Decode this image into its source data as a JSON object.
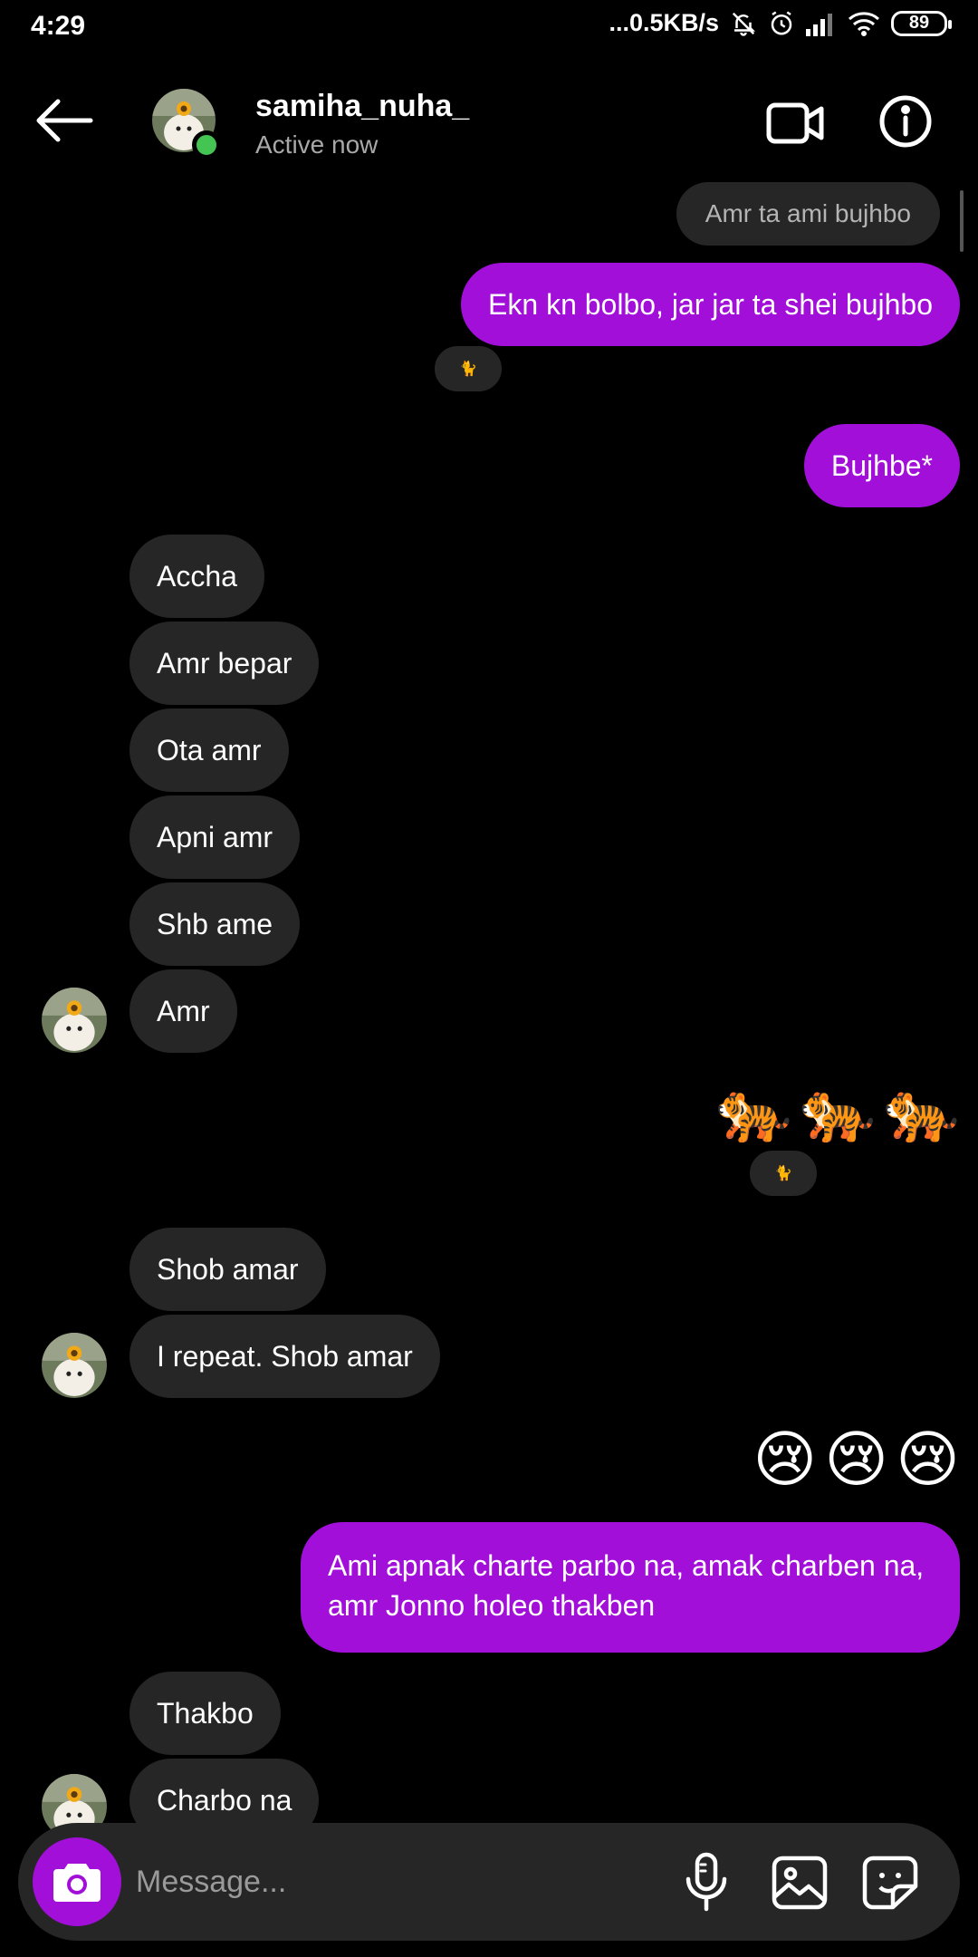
{
  "status_bar": {
    "time": "4:29",
    "network_speed": "...0.5KB/s",
    "battery": "89",
    "icons": [
      "mute-icon",
      "alarm-icon",
      "signal-icon",
      "wifi-icon",
      "battery-icon"
    ]
  },
  "header": {
    "name": "samiha_nuha_",
    "status": "Active now",
    "icons": [
      "back-arrow-icon",
      "video-call-icon",
      "info-icon"
    ]
  },
  "messages": {
    "reply_preview": "Amr ta ami bujhbo",
    "m1": "Ekn kn bolbo, jar jar ta shei bujhbo",
    "m1_reaction": "🐈",
    "m2": "Bujhbe*",
    "m3": "Accha",
    "m4": "Amr bepar",
    "m5": "Ota amr",
    "m6": "Apni amr",
    "m7": "Shb ame",
    "m8": "Amr",
    "m9_emojis": [
      "🐅",
      "🐅",
      "🐅"
    ],
    "m9_reaction": "🐈",
    "m10": "Shob amar",
    "m11": "I repeat. Shob amar",
    "m12_emojis": [
      "😢",
      "😢",
      "😢"
    ],
    "m13": "Ami apnak charte parbo na, amak charben na, amr Jonno holeo thakben",
    "m14": "Thakbo",
    "m15": "Charbo na"
  },
  "composer": {
    "placeholder": "Message...",
    "icons": [
      "camera-icon",
      "microphone-icon",
      "gallery-icon",
      "sticker-icon"
    ]
  },
  "colors": {
    "background": "#000000",
    "outgoing_bubble": "#a10fd8",
    "incoming_bubble": "#262626",
    "online": "#44c553",
    "secondary_text": "#a8a8a8"
  }
}
